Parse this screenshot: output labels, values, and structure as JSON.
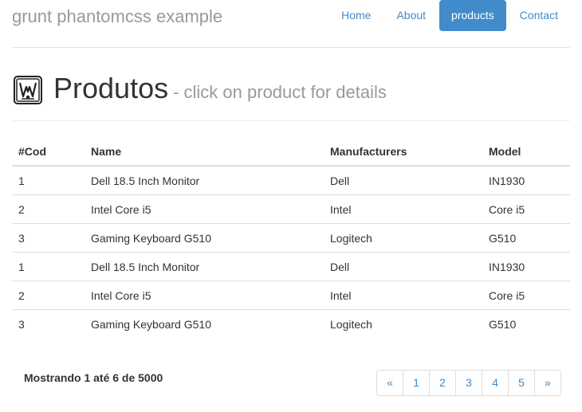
{
  "header": {
    "brand": "grunt phantomcss example",
    "nav": [
      {
        "label": "Home"
      },
      {
        "label": "About"
      },
      {
        "label": "products",
        "active": true
      },
      {
        "label": "Contact"
      }
    ]
  },
  "page_header": {
    "logo_icon": "framed-emblem-logo",
    "title": "Produtos",
    "subtitle": "- click on product for details"
  },
  "table": {
    "headers": [
      "#Cod",
      "Name",
      "Manufacturers",
      "Model"
    ],
    "rows": [
      [
        "1",
        "Dell 18.5 Inch Monitor",
        "Dell",
        "IN1930"
      ],
      [
        "2",
        "Intel Core i5",
        "Intel",
        "Core i5"
      ],
      [
        "3",
        "Gaming Keyboard G510",
        "Logitech",
        "G510"
      ],
      [
        "1",
        "Dell 18.5 Inch Monitor",
        "Dell",
        "IN1930"
      ],
      [
        "2",
        "Intel Core i5",
        "Intel",
        "Core i5"
      ],
      [
        "3",
        "Gaming Keyboard G510",
        "Logitech",
        "G510"
      ]
    ]
  },
  "footer": {
    "showing": "Mostrando 1 até 6 de 5000",
    "pagination": [
      "«",
      "1",
      "2",
      "3",
      "4",
      "5",
      "»"
    ]
  },
  "colors": {
    "accent": "#428bca",
    "muted": "#999999"
  }
}
